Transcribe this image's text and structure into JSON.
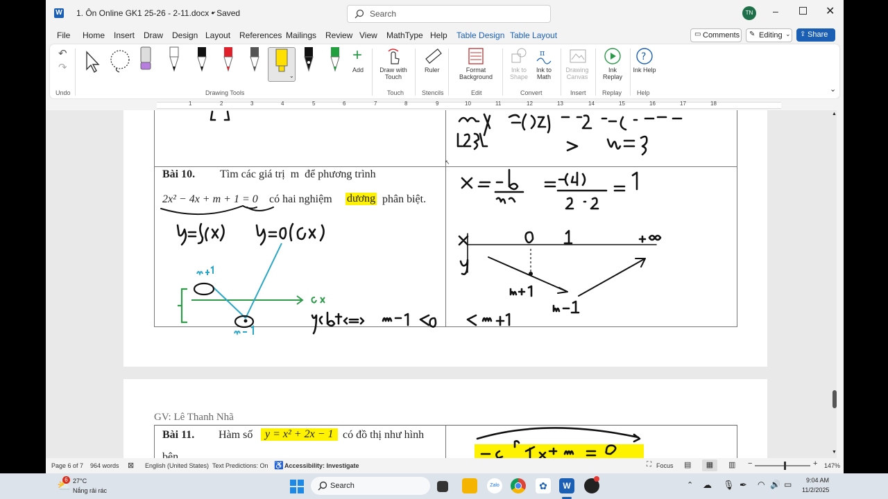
{
  "window": {
    "doc_title": "1. Ôn Online GK1 25-26 - 2-11.docx • Saved",
    "search_placeholder": "Search",
    "user_initials": "TN"
  },
  "menu": {
    "items": [
      "File",
      "Home",
      "Insert",
      "Draw",
      "Design",
      "Layout",
      "References",
      "Mailings",
      "Review",
      "View",
      "MathType",
      "Help",
      "Table Design",
      "Table Layout"
    ],
    "active": "Draw",
    "comments_label": "Comments",
    "editing_label": "Editing",
    "share_label": "Share"
  },
  "ribbon": {
    "undo_group": "Undo",
    "drawing_tools_group": "Drawing Tools",
    "add_label": "Add",
    "draw_with_touch": "Draw with Touch",
    "touch_group": "Touch",
    "ruler_label": "Ruler",
    "stencils_group": "Stencils",
    "format_background": "Format Background",
    "edit_group": "Edit",
    "ink_to_shape": "Ink to Shape",
    "ink_to_math": "Ink to Math",
    "convert_group": "Convert",
    "drawing_canvas": "Drawing Canvas",
    "insert_group": "Insert",
    "ink_replay": "Ink Replay",
    "replay_group": "Replay",
    "ink_help": "Ink Help",
    "help_group": "Help",
    "pen_colors": [
      "#111111",
      "#e0202a",
      "#555555",
      "#ffe000",
      "#111111",
      "#22a040"
    ]
  },
  "ruler": {
    "ticks": [
      "1",
      "2",
      "3",
      "4",
      "5",
      "6",
      "7",
      "8",
      "9",
      "10",
      "11",
      "12",
      "13",
      "14",
      "15",
      "16",
      "17",
      "18"
    ]
  },
  "page1": {
    "bai10_label": "Bài 10.",
    "bai10_text": "Tìm các giá trị  m  để phương trình",
    "equation": "2x² − 4x + m + 1 = 0",
    "eq_rest_1": "có hai nghiệm",
    "highlight_word": "dương",
    "eq_rest_2": "phân biệt."
  },
  "page2": {
    "author": "GV: Lê Thanh Nhã",
    "bai11_label": "Bài 11.",
    "bai11_text1": "Hàm số",
    "bai11_eq": "y = x² + 2x − 1",
    "bai11_text2": "có đồ thị như hình",
    "bai11_cont": "bên."
  },
  "status": {
    "page": "Page 6 of 7",
    "words": "964 words",
    "language": "English (United States)",
    "predictions": "Text Predictions: On",
    "accessibility": "Accessibility: Investigate",
    "focus": "Focus",
    "zoom": "147%"
  },
  "taskbar": {
    "weather_temp": "27°C",
    "weather_desc": "Nắng rải rác",
    "weather_badge": "6",
    "search_label": "Search",
    "time": "9:04 AM",
    "date": "11/2/2025"
  }
}
